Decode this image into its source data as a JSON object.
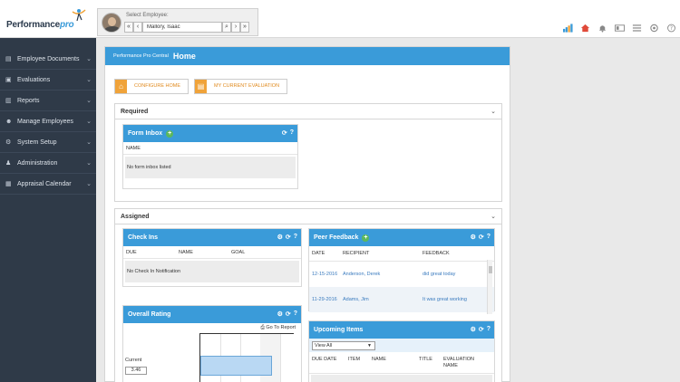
{
  "brand": {
    "name_a": "Performance",
    "name_b": "pro"
  },
  "employee": {
    "label": "Select Employee:",
    "value": "Mallory, Isaac",
    "first": "«",
    "prev": "‹",
    "next": "›",
    "last": "»",
    "search": "⌕"
  },
  "sidebar": {
    "items": [
      {
        "label": "Employee Documents",
        "icon": "doc-icon",
        "glyph": "▤"
      },
      {
        "label": "Evaluations",
        "icon": "eval-icon",
        "glyph": "▣"
      },
      {
        "label": "Reports",
        "icon": "report-icon",
        "glyph": "▥"
      },
      {
        "label": "Manage Employees",
        "icon": "people-icon",
        "glyph": "☻"
      },
      {
        "label": "System Setup",
        "icon": "gear-icon",
        "glyph": "⚙"
      },
      {
        "label": "Administration",
        "icon": "admin-icon",
        "glyph": "♟"
      },
      {
        "label": "Appraisal Calendar",
        "icon": "calendar-icon",
        "glyph": "▦"
      }
    ]
  },
  "header": {
    "small": "Performance Pro Central",
    "title": "Home"
  },
  "buttons": {
    "configure": "CONFIGURE HOME",
    "current_eval": "MY CURRENT EVALUATION"
  },
  "required": {
    "title": "Required",
    "form_inbox": {
      "title": "Form Inbox",
      "col_name": "NAME",
      "empty": "No form inbox listed"
    }
  },
  "assigned": {
    "title": "Assigned",
    "checkins": {
      "title": "Check Ins",
      "cols": [
        "DUE",
        "NAME",
        "GOAL"
      ],
      "empty": "No Check In Notification"
    },
    "peer": {
      "title": "Peer Feedback",
      "cols": [
        "DATE",
        "RECIPIENT",
        "FEEDBACK"
      ],
      "rows": [
        {
          "date": "12-15-2016",
          "recipient": "Anderson, Derek",
          "feedback": "did great today"
        },
        {
          "date": "11-29-2016",
          "recipient": "Adams, Jim",
          "feedback": "It was great working"
        }
      ]
    },
    "rating": {
      "title": "Overall Rating",
      "goto": "Go To Report",
      "current_label": "Current",
      "current_value": "3.46",
      "bar_fraction": 0.77
    },
    "upcoming": {
      "title": "Upcoming Items",
      "filter": "View All",
      "cols": [
        "DUE DATE",
        "ITEM",
        "NAME",
        "TITLE",
        "EVALUATION NAME"
      ]
    }
  },
  "colors": {
    "accent": "#3a9bd9",
    "sidebar": "#2f3a48",
    "orange": "#f0a33a"
  }
}
